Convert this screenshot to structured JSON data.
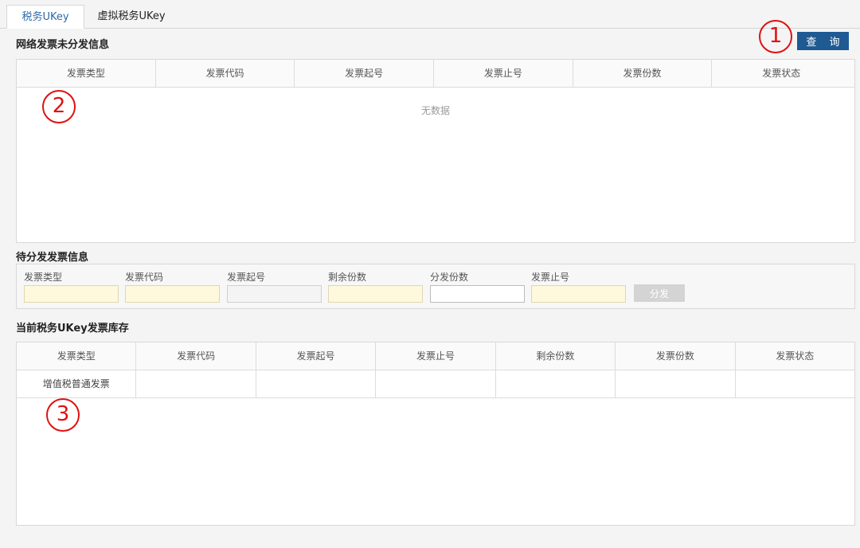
{
  "tabs": [
    {
      "label": "税务UKey",
      "active": true
    },
    {
      "label": "虚拟税务UKey",
      "active": false
    }
  ],
  "sections": {
    "network_unissued": "网络发票未分发信息",
    "pending_distribution": "待分发发票信息",
    "current_inventory": "当前税务UKey发票库存"
  },
  "query_button": "查 询",
  "unissued_table": {
    "columns": [
      "发票类型",
      "发票代码",
      "发票起号",
      "发票止号",
      "发票份数",
      "发票状态"
    ],
    "empty_text": "无数据"
  },
  "distribution_form": {
    "fields": [
      {
        "label": "发票类型",
        "value": ""
      },
      {
        "label": "发票代码",
        "value": ""
      },
      {
        "label": "发票起号",
        "value": ""
      },
      {
        "label": "剩余份数",
        "value": ""
      },
      {
        "label": "分发份数",
        "value": ""
      },
      {
        "label": "发票止号",
        "value": ""
      }
    ],
    "button": "分发"
  },
  "inventory_table": {
    "columns": [
      "发票类型",
      "发票代码",
      "发票起号",
      "发票止号",
      "剩余份数",
      "发票份数",
      "发票状态"
    ],
    "rows": [
      [
        "增值税普通发票",
        "",
        "",
        "",
        "",
        "",
        ""
      ]
    ]
  },
  "annotations": [
    "1",
    "2",
    "3"
  ],
  "colors": {
    "primary": "#1f5a93",
    "annotation": "#e01010",
    "readonly_field": "#fef8dc"
  }
}
